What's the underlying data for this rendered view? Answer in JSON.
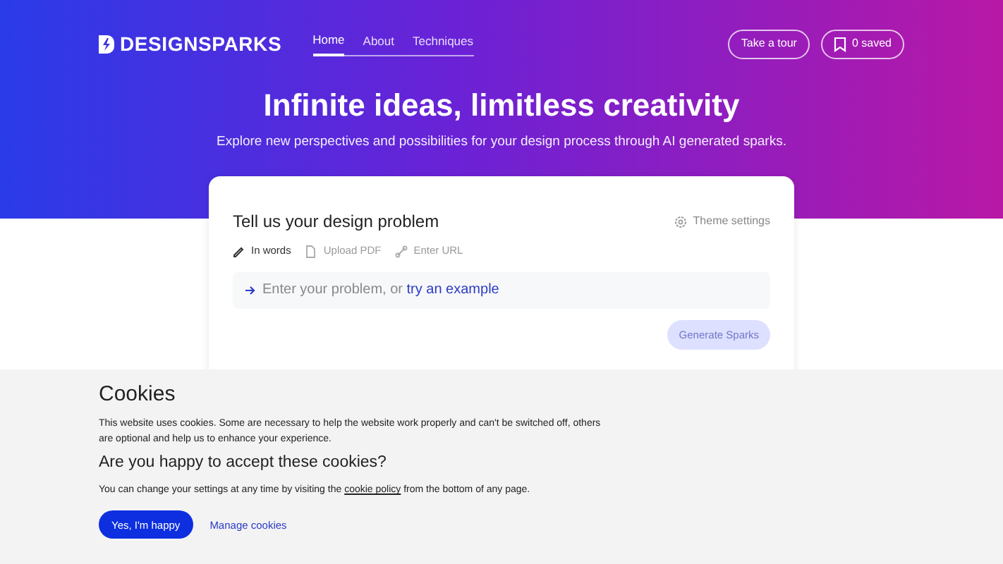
{
  "brand": {
    "name": "DESIGNSPARKS"
  },
  "nav": [
    {
      "label": "Home",
      "selected": true
    },
    {
      "label": "About",
      "selected": false
    },
    {
      "label": "Techniques",
      "selected": false
    }
  ],
  "header_buttons": [
    {
      "label": "Take a tour",
      "kind": "text"
    },
    {
      "label": "0 saved",
      "kind": "bookmark"
    }
  ],
  "hero": {
    "title": "Infinite ideas, limitless creativity",
    "subtitle": "Explore new perspectives and possibilities for your design process through AI generated sparks."
  },
  "problem_card": {
    "title": "Tell us your design problem",
    "settings": "Theme settings",
    "input_tabs": [
      {
        "label": "In words",
        "kind": "pencil",
        "selected": true
      },
      {
        "label": "Upload PDF",
        "kind": "file",
        "selected": false
      },
      {
        "label": "Enter URL",
        "kind": "link",
        "selected": false
      }
    ],
    "prompt": {
      "text": "Enter your problem, or",
      "link": "try an example"
    },
    "submit": {
      "label": "Generate Sparks",
      "disabled": true
    }
  },
  "cookies": {
    "title": "Cookies",
    "intro": "This website uses cookies. Some are necessary to help the website work properly and can't be switched off, others are optional and help us to enhance your experience.",
    "question": "Are you happy to accept these cookies?",
    "policy": {
      "before": "You can change your settings at any time by visiting the",
      "link": "cookie policy",
      "after": "from the bottom of any page."
    },
    "accept": "Yes, I'm happy",
    "manage": "Manage cookies"
  }
}
